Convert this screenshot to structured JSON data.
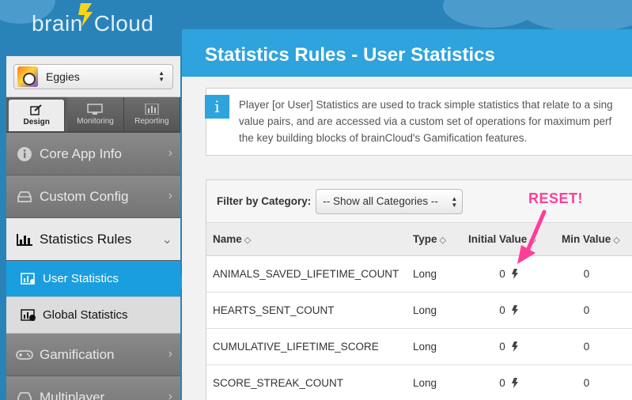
{
  "brand": {
    "name_part1": "brain",
    "name_part2": "Cloud"
  },
  "app_selector": {
    "selected_app": "Eggies"
  },
  "mode_tabs": [
    {
      "label": "Design",
      "icon": "pencil-icon"
    },
    {
      "label": "Monitoring",
      "icon": "monitor-icon"
    },
    {
      "label": "Reporting",
      "icon": "bar-chart-icon"
    }
  ],
  "nav": {
    "core_app_info": "Core App Info",
    "custom_config": "Custom Config",
    "statistics_rules": "Statistics Rules",
    "user_statistics": "User Statistics",
    "global_statistics": "Global Statistics",
    "gamification": "Gamification",
    "multiplayer": "Multiplayer"
  },
  "page": {
    "title": "Statistics Rules - User Statistics"
  },
  "info": {
    "icon_text": "i",
    "line1": "Player [or User] Statistics are used to track simple statistics that relate to a sing",
    "line2": "value pairs, and are accessed via a custom set of operations for maximum perf",
    "line3": "the key building blocks of brainCloud's Gamification features."
  },
  "filter": {
    "label": "Filter by Category:",
    "selected": "-- Show all Categories --"
  },
  "table": {
    "headers": {
      "name": "Name",
      "type": "Type",
      "initial_value": "Initial Value",
      "min_value": "Min Value"
    },
    "rows": [
      {
        "name": "ANIMALS_SAVED_LIFETIME_COUNT",
        "type": "Long",
        "initial": "0",
        "min": "0"
      },
      {
        "name": "HEARTS_SENT_COUNT",
        "type": "Long",
        "initial": "0",
        "min": "0"
      },
      {
        "name": "CUMULATIVE_LIFETIME_SCORE",
        "type": "Long",
        "initial": "0",
        "min": "0"
      },
      {
        "name": "SCORE_STREAK_COUNT",
        "type": "Long",
        "initial": "0",
        "min": "0"
      }
    ]
  },
  "annotation": {
    "text": "RESET!",
    "color": "#ff3e96"
  },
  "colors": {
    "accent": "#2ea3de",
    "active_nav": "#1a9ee0",
    "background": "#2a83b8"
  }
}
